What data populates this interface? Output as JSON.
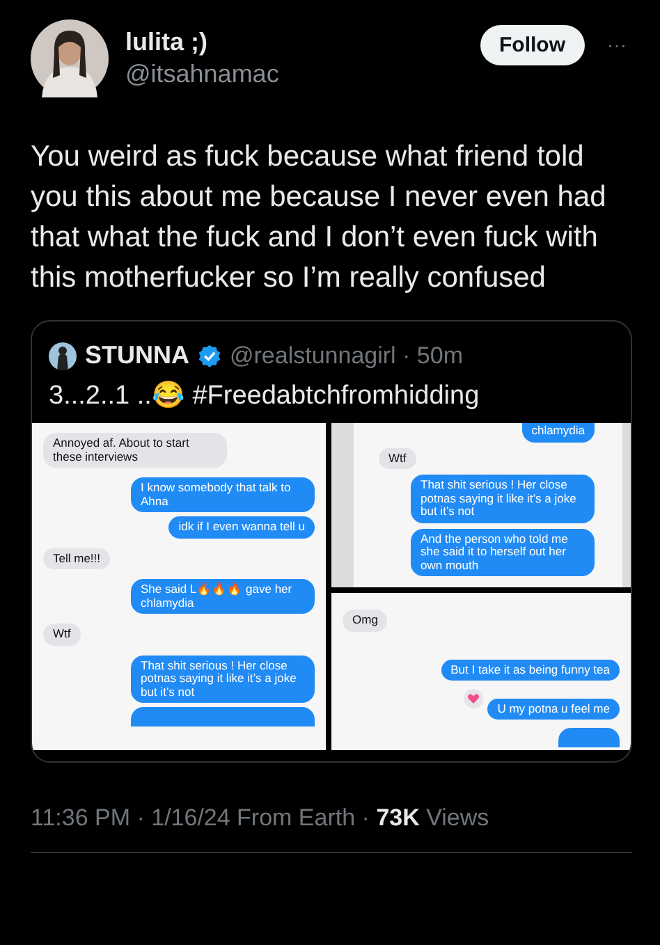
{
  "author": {
    "name": "lulita ;)",
    "handle": "@itsahnamac"
  },
  "follow_button": "Follow",
  "more_button": "···",
  "text": "You weird as fuck because what friend told you this about me because I never even had that what the fuck and I don’t even fuck with this motherfucker so I’m really confused",
  "quote": {
    "name": "STUNNA",
    "handle_time": "@realstunnagirl · 50m",
    "text": "3...2..1 ..😂 #Freedabtchfromhidding",
    "screenshots": [
      {
        "messages": [
          {
            "kind": "received",
            "text": "Annoyed af. About to start these interviews",
            "cut_off": false,
            "hearted": false
          },
          {
            "kind": "sent",
            "text": "I know somebody that talk to Ahna",
            "cut_off": false,
            "hearted": false
          },
          {
            "kind": "sent",
            "text": "idk if I even wanna tell u",
            "cut_off": false,
            "hearted": false
          },
          {
            "kind": "received",
            "text": "Tell me!!!",
            "cut_off": false,
            "hearted": false
          },
          {
            "kind": "sent",
            "text": "She said L🔥🔥🔥 gave her chlamydia",
            "cut_off": false,
            "hearted": false
          },
          {
            "kind": "received",
            "text": "Wtf",
            "cut_off": false,
            "hearted": false
          },
          {
            "kind": "sent",
            "text": "That shit serious ! Her close potnas saying it like it’s a joke but it’s not",
            "cut_off": false,
            "hearted": false
          },
          {
            "kind": "sent",
            "cut_off": true,
            "hearted": false
          }
        ]
      },
      {
        "messages": [
          {
            "kind": "sent",
            "text": "chlamydia",
            "cut_off": true,
            "hearted": false
          },
          {
            "kind": "received",
            "text": "Wtf",
            "cut_off": false,
            "hearted": false
          },
          {
            "kind": "sent",
            "text": "That shit serious ! Her close potnas saying it like it’s a joke but it’s not",
            "cut_off": false,
            "hearted": false
          },
          {
            "kind": "sent",
            "text": "And the person who told me she said it to herself out her own mouth",
            "cut_off": false,
            "hearted": false
          }
        ]
      },
      {
        "messages": [
          {
            "kind": "received",
            "text": "Omg",
            "cut_off": false,
            "hearted": false
          },
          {
            "kind": "sent",
            "text": "But I take it as being funny tea",
            "cut_off": false,
            "hearted": false
          },
          {
            "kind": "sent",
            "text": "U my potna u feel me",
            "cut_off": false,
            "hearted": true
          },
          {
            "kind": "sent",
            "cut_off": true,
            "hearted": false
          }
        ]
      }
    ]
  },
  "footer": "11:36 PM · 1/16/24 From Earth · **73K** Views"
}
